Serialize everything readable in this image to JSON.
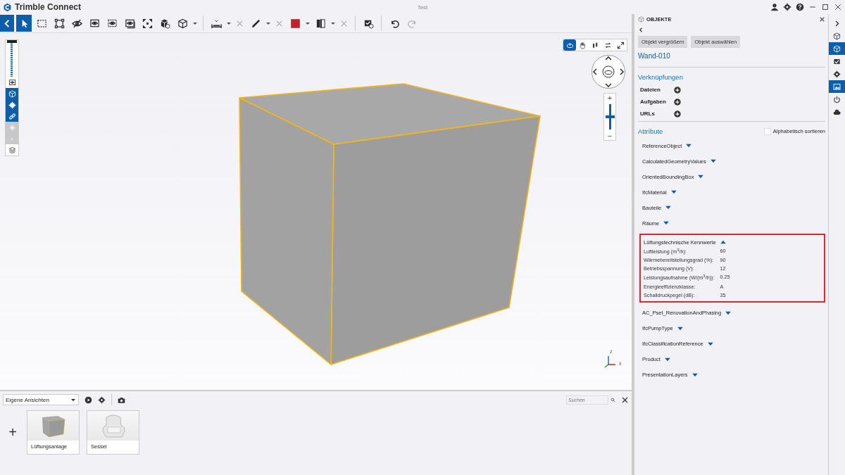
{
  "window": {
    "app_title": "Trimble Connect",
    "title": "Test"
  },
  "toolbar": {
    "back": {
      "selected": true
    },
    "tools": [
      {
        "kind": "select",
        "selected": true,
        "dropdown": false,
        "clear": false
      },
      {
        "kind": "marquee",
        "selected": false,
        "dropdown": false,
        "clear": false
      },
      {
        "kind": "fit",
        "selected": false,
        "dropdown": false,
        "clear": false
      },
      {
        "kind": "hide",
        "selected": false,
        "dropdown": false,
        "clear": false
      },
      {
        "kind": "isolate",
        "selected": false,
        "dropdown": false,
        "clear": false
      },
      {
        "kind": "ghost",
        "selected": false,
        "dropdown": false,
        "clear": false
      },
      {
        "kind": "transparent",
        "selected": false,
        "dropdown": false,
        "clear": false
      },
      {
        "kind": "expand",
        "selected": false,
        "dropdown": false,
        "clear": false
      },
      {
        "kind": "object",
        "selected": false,
        "dropdown": false,
        "clear": false
      },
      {
        "kind": "cube",
        "selected": false,
        "dropdown": true,
        "clear": false
      },
      {
        "kind": "measure",
        "selected": false,
        "dropdown": true,
        "clear": true
      },
      {
        "kind": "pen",
        "selected": false,
        "dropdown": true,
        "clear": true
      },
      {
        "kind": "color",
        "selected": false,
        "dropdown": true,
        "clear": false
      },
      {
        "kind": "section",
        "selected": false,
        "dropdown": true,
        "clear": true
      },
      {
        "kind": "markup",
        "selected": false,
        "dropdown": false,
        "clear": false
      },
      {
        "kind": "undo",
        "selected": false,
        "dropdown": false,
        "clear": false
      },
      {
        "kind": "redo",
        "selected": false,
        "dropdown": false,
        "clear": false,
        "disabled": true
      }
    ]
  },
  "side_toolbar": {
    "slider": {
      "level": 1
    },
    "items": [
      {
        "kind": "eye",
        "selected": false,
        "disabled": false
      },
      {
        "kind": "box",
        "selected": true,
        "disabled": false
      },
      {
        "kind": "gear",
        "selected": true,
        "disabled": false
      },
      {
        "kind": "link",
        "selected": true,
        "disabled": false
      },
      {
        "kind": "gear",
        "selected": false,
        "disabled": true
      },
      {
        "kind": "arrow",
        "selected": false,
        "disabled": true
      },
      {
        "kind": "layers",
        "selected": false,
        "disabled": false
      }
    ]
  },
  "navigation": {
    "modes": [
      {
        "kind": "orbit",
        "selected": true
      },
      {
        "kind": "pan",
        "selected": false
      },
      {
        "kind": "walk",
        "selected": false
      },
      {
        "kind": "swap",
        "selected": false
      },
      {
        "kind": "fullscreen",
        "selected": false
      }
    ],
    "zoom": {
      "level": 0.5,
      "plus": "+",
      "minus": "−"
    },
    "axes": [
      "z",
      "x"
    ]
  },
  "views_panel": {
    "dropdown": "Eigene Ansichten",
    "search": {
      "placeholder": "Suchen"
    },
    "add": "+",
    "views": [
      {
        "kind": "box",
        "label": "Lüftungsanlage"
      },
      {
        "kind": "chair",
        "label": "Sessel"
      }
    ]
  },
  "object_panel": {
    "title": "OBJEKTE",
    "buttons": [
      "Objekt vergrößern",
      "Objekt auswählen"
    ],
    "object_name": "Wand-010",
    "links_heading": "Verknüpfungen",
    "links": [
      "Dateien",
      "Aufgaben",
      "URLs"
    ],
    "attributes_heading": "Attribute",
    "sort": {
      "label": "Alphabetisch sortieren",
      "checked": false
    },
    "property_sets": [
      {
        "name": "ReferenceObject",
        "expanded": false
      },
      {
        "name": "CalculatedGeometryValues",
        "expanded": false
      },
      {
        "name": "OrientedBoundingBox",
        "expanded": false
      },
      {
        "name": "IfcMaterial",
        "expanded": false
      },
      {
        "name": "Bauteile",
        "expanded": false
      },
      {
        "name": "Räume",
        "expanded": false
      },
      {
        "name": "Lüftungstechnische Kennwerte",
        "expanded": true,
        "highlighted": true,
        "properties": [
          {
            "name": "Luftleistung (m$^{3}$/h):",
            "value": "60"
          },
          {
            "name": "Wärmebereitstellungsgrad (%):",
            "value": "90"
          },
          {
            "name": "Betriebsspannung (V):",
            "value": "12"
          },
          {
            "name": "Leistungsaufnahme (W/(m$^{3}$/h)):",
            "value": "0.25"
          },
          {
            "name": "Energieeffizienzklasse:",
            "value": "A"
          },
          {
            "name": "Schalldruckpegel (dB):",
            "value": "35"
          }
        ]
      },
      {
        "name": "AC_Pset_RenovationAndPhasing",
        "expanded": false
      },
      {
        "name": "IfcPumpType",
        "expanded": false
      },
      {
        "name": "IfcClassificationReference",
        "expanded": false
      },
      {
        "name": "Product",
        "expanded": false
      },
      {
        "name": "PresentationLayers",
        "expanded": false
      }
    ]
  },
  "right_strip": {
    "items": [
      {
        "kind": "chevron",
        "selected": false
      },
      {
        "kind": "cube",
        "selected": false
      },
      {
        "kind": "box",
        "selected": true
      },
      {
        "kind": "check",
        "selected": false
      },
      {
        "kind": "gear",
        "selected": false
      },
      {
        "kind": "image",
        "selected": true
      },
      {
        "kind": "power",
        "selected": false
      },
      {
        "kind": "cloud",
        "selected": false
      }
    ]
  }
}
